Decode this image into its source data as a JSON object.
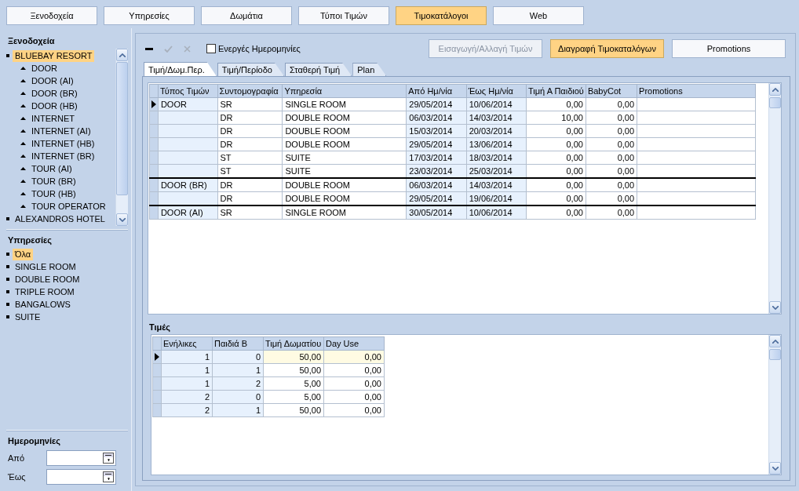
{
  "nav": [
    {
      "label": "Ξενοδοχεία",
      "selected": false
    },
    {
      "label": "Υπηρεσίες",
      "selected": false
    },
    {
      "label": "Δωμάτια",
      "selected": false
    },
    {
      "label": "Τύποι Τιμών",
      "selected": false
    },
    {
      "label": "Τιμοκατάλογοι",
      "selected": true
    },
    {
      "label": "Web",
      "selected": false
    }
  ],
  "sidebar": {
    "hotels_title": "Ξενοδοχεία",
    "hotels": [
      {
        "label": "BLUEBAY RESORT",
        "selected": true,
        "expanded": true,
        "children": [
          {
            "label": "DOOR"
          },
          {
            "label": "DOOR (AI)"
          },
          {
            "label": "DOOR (BR)"
          },
          {
            "label": "DOOR (HB)"
          },
          {
            "label": "INTERNET"
          },
          {
            "label": "INTERNET  (AI)"
          },
          {
            "label": "INTERNET  (HB)"
          },
          {
            "label": "INTERNET (BR)"
          },
          {
            "label": "TOUR (AI)"
          },
          {
            "label": "TOUR (BR)"
          },
          {
            "label": "TOUR (HB)"
          },
          {
            "label": "TOUR OPERATOR"
          }
        ]
      },
      {
        "label": "ALEXANDROS HOTEL",
        "selected": false,
        "expanded": false
      }
    ],
    "services_title": "Υπηρεσίες",
    "services": [
      {
        "label": "Όλα",
        "selected": true
      },
      {
        "label": "SINGLE ROOM",
        "selected": false
      },
      {
        "label": "DOUBLE ROOM",
        "selected": false
      },
      {
        "label": "TRIPLE ROOM",
        "selected": false
      },
      {
        "label": "BANGALOWS",
        "selected": false
      },
      {
        "label": "SUITE",
        "selected": false
      }
    ],
    "dates_title": "Ημερομηνίες",
    "date_fields": [
      {
        "label": "Από"
      },
      {
        "label": "Έως"
      }
    ]
  },
  "toolbar": {
    "actions": [
      {
        "kind": "remove",
        "disabled": false
      },
      {
        "kind": "confirm",
        "disabled": true
      },
      {
        "kind": "cancel",
        "disabled": true
      }
    ],
    "active_dates": {
      "label": "Ενεργές Ημερομηνίες",
      "checked": false
    },
    "buttons": [
      {
        "label": "Εισαγωγή/Αλλαγή Τιμών",
        "disabled": true,
        "selected": false
      },
      {
        "label": "Διαγραφή Τιμοκαταλόγων",
        "disabled": false,
        "selected": true
      },
      {
        "label": "Promotions",
        "disabled": false,
        "selected": false
      }
    ]
  },
  "tabs": [
    {
      "label": "Τιμή/Δωμ.Περ.",
      "selected": true
    },
    {
      "label": "Τιμή/Περίοδο",
      "selected": false
    },
    {
      "label": "Σταθερή Τιμή",
      "selected": false
    },
    {
      "label": "Plan",
      "selected": false
    }
  ],
  "rates_table": {
    "columns": [
      "Τύπος Τιμών",
      "Συντομογραφία",
      "Υπηρεσία",
      "Από Ημ/νία",
      "Έως Ημ/νία",
      "Τιμή Α Παιδιού",
      "BabyCot",
      "Promotions"
    ],
    "rows": [
      {
        "cells": [
          "DOOR",
          "SR",
          "SINGLE ROOM",
          "29/05/2014",
          "10/06/2014",
          "0,00",
          "0,00"
        ],
        "selected": true
      },
      {
        "cells": [
          "",
          "DR",
          "DOUBLE ROOM",
          "06/03/2014",
          "14/03/2014",
          "10,00",
          "0,00"
        ],
        "selected": false
      },
      {
        "cells": [
          "",
          "DR",
          "DOUBLE ROOM",
          "15/03/2014",
          "20/03/2014",
          "0,00",
          "0,00"
        ],
        "selected": false
      },
      {
        "cells": [
          "",
          "DR",
          "DOUBLE ROOM",
          "29/05/2014",
          "13/06/2014",
          "0,00",
          "0,00"
        ],
        "selected": false
      },
      {
        "cells": [
          "",
          "ST",
          "SUITE",
          "17/03/2014",
          "18/03/2014",
          "0,00",
          "0,00"
        ],
        "selected": false
      },
      {
        "cells": [
          "",
          "ST",
          "SUITE",
          "23/03/2014",
          "25/03/2014",
          "0,00",
          "0,00"
        ],
        "selected": false
      },
      {
        "cells": [
          "DOOR (BR)",
          "DR",
          "DOUBLE ROOM",
          "06/03/2014",
          "14/03/2014",
          "0,00",
          "0,00"
        ],
        "selected": false
      },
      {
        "cells": [
          "",
          "DR",
          "DOUBLE ROOM",
          "29/05/2014",
          "19/06/2014",
          "0,00",
          "0,00"
        ],
        "selected": false
      },
      {
        "cells": [
          "DOOR (AI)",
          "SR",
          "SINGLE ROOM",
          "30/05/2014",
          "10/06/2014",
          "0,00",
          "0,00"
        ],
        "selected": false
      }
    ]
  },
  "prices_title": "Τιμές",
  "prices_table": {
    "columns": [
      "Ενήλικες",
      "Παιδιά Β",
      "Τιμή Δωματίου",
      "Day Use"
    ],
    "rows": [
      {
        "cells": [
          "1",
          "0",
          "50,00",
          "0,00"
        ],
        "selected": true
      },
      {
        "cells": [
          "1",
          "1",
          "50,00",
          "0,00"
        ],
        "selected": false
      },
      {
        "cells": [
          "1",
          "2",
          "5,00",
          "0,00"
        ],
        "selected": false
      },
      {
        "cells": [
          "2",
          "0",
          "5,00",
          "0,00"
        ],
        "selected": false
      },
      {
        "cells": [
          "2",
          "1",
          "50,00",
          "0,00"
        ],
        "selected": false
      }
    ]
  }
}
